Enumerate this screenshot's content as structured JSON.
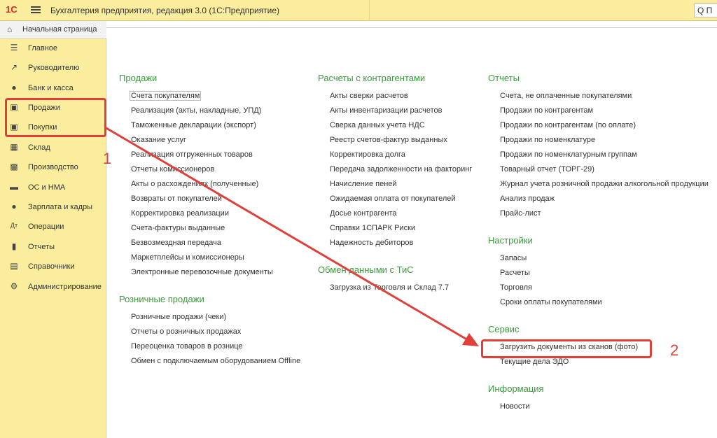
{
  "titlebar": {
    "logo": "1С",
    "title": "Бухгалтерия предприятия, редакция 3.0  (1С:Предприятие)",
    "search_text": "Q П"
  },
  "home": {
    "label": "Начальная страница",
    "icon": "home-icon"
  },
  "sidebar": {
    "items": [
      {
        "label": "Главное",
        "icon": "menu-lines-icon"
      },
      {
        "label": "Руководителю",
        "icon": "trend-icon"
      },
      {
        "label": "Банк и касса",
        "icon": "coin-icon"
      },
      {
        "label": "Продажи",
        "icon": "bag-icon"
      },
      {
        "label": "Покупки",
        "icon": "cart-icon"
      },
      {
        "label": "Склад",
        "icon": "grid-icon"
      },
      {
        "label": "Производство",
        "icon": "factory-icon"
      },
      {
        "label": "ОС и НМА",
        "icon": "truck-icon"
      },
      {
        "label": "Зарплата и кадры",
        "icon": "person-icon"
      },
      {
        "label": "Операции",
        "icon": "dt-kt-icon"
      },
      {
        "label": "Отчеты",
        "icon": "bar-chart-icon"
      },
      {
        "label": "Справочники",
        "icon": "book-icon"
      },
      {
        "label": "Администрирование",
        "icon": "gear-icon"
      }
    ]
  },
  "main": {
    "col1": {
      "sections": [
        {
          "title": "Продажи",
          "links": [
            "Счета покупателям",
            "Реализация (акты, накладные, УПД)",
            "Таможенные декларации (экспорт)",
            "Оказание услуг",
            "Реализация отгруженных товаров",
            "Отчеты комиссионеров",
            "Акты о расхождениях (полученные)",
            "Возвраты от покупателей",
            "Корректировка реализации",
            "Счета-фактуры выданные",
            "Безвозмездная передача",
            "Маркетплейсы и комиссионеры",
            "Электронные перевозочные документы"
          ]
        },
        {
          "title": "Розничные продажи",
          "links": [
            "Розничные продажи (чеки)",
            "Отчеты о розничных продажах",
            "Переоценка товаров в рознице",
            "Обмен с подключаемым оборудованием Offline"
          ]
        }
      ]
    },
    "col2": {
      "sections": [
        {
          "title": "Расчеты с контрагентами",
          "links": [
            "Акты сверки расчетов",
            "Акты инвентаризации расчетов",
            "Сверка данных учета НДС",
            "Реестр счетов-фактур выданных",
            "Корректировка долга",
            "Передача задолженности на факторинг",
            "Начисление пеней",
            "Ожидаемая оплата от покупателей",
            "Досье контрагента",
            "Справки 1СПАРК Риски",
            "Надежность дебиторов"
          ]
        },
        {
          "title": "Обмен данными с ТиС",
          "links": [
            "Загрузка из Торговля и Склад 7.7"
          ]
        }
      ]
    },
    "col3": {
      "sections": [
        {
          "title": "Отчеты",
          "links": [
            "Счета, не оплаченные покупателями",
            "Продажи по контрагентам",
            "Продажи по контрагентам (по оплате)",
            "Продажи по номенклатуре",
            "Продажи по номенклатурным группам",
            "Товарный отчет (ТОРГ-29)",
            "Журнал учета розничной продажи алкогольной продукции",
            "Анализ продаж",
            "Прайс-лист"
          ]
        },
        {
          "title": "Настройки",
          "links": [
            "Запасы",
            "Расчеты",
            "Торговля",
            "Сроки оплаты покупателями"
          ]
        },
        {
          "title": "Сервис",
          "links": [
            "Загрузить документы из сканов (фото)",
            "Текущие дела ЭДО"
          ]
        },
        {
          "title": "Информация",
          "links": [
            "Новости"
          ]
        }
      ]
    }
  },
  "annotations": {
    "step1": "1",
    "step2": "2"
  },
  "colors": {
    "sidebar_bg": "#fbed9e",
    "section_title": "#3b9a3b",
    "annotation": "#e0403a"
  }
}
